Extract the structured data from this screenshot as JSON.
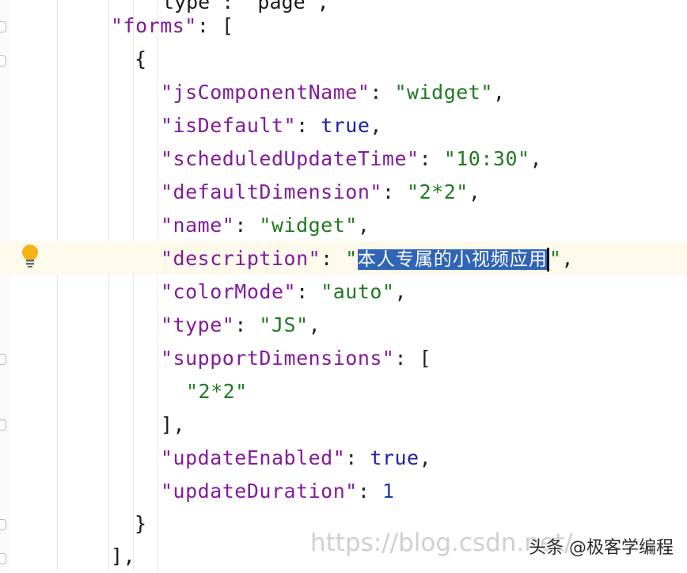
{
  "editor": {
    "top_partial": "type\": \"page\",",
    "lines": {
      "forms_open": {
        "key": "\"forms\"",
        "sep": ": ",
        "open": "["
      },
      "obj_open": "{",
      "jsComponentName": {
        "key": "\"jsComponentName\"",
        "sep": ": ",
        "value": "\"widget\"",
        "end": ","
      },
      "isDefault": {
        "key": "\"isDefault\"",
        "sep": ": ",
        "value": "true",
        "end": ","
      },
      "scheduledUpdateTime": {
        "key": "\"scheduledUpdateTime\"",
        "sep": ": ",
        "value": "\"10:30\"",
        "end": ","
      },
      "defaultDimension": {
        "key": "\"defaultDimension\"",
        "sep": ": ",
        "value": "\"2*2\"",
        "end": ","
      },
      "name": {
        "key": "\"name\"",
        "sep": ": ",
        "value": "\"widget\"",
        "end": ","
      },
      "description": {
        "key": "\"description\"",
        "sep": ": ",
        "quote_open": "\"",
        "value": "本人专属的小视频应用",
        "quote_close": "\"",
        "end": ","
      },
      "colorMode": {
        "key": "\"colorMode\"",
        "sep": ": ",
        "value": "\"auto\"",
        "end": ","
      },
      "type": {
        "key": "\"type\"",
        "sep": ": ",
        "value": "\"JS\"",
        "end": ","
      },
      "supportDimensions": {
        "key": "\"supportDimensions\"",
        "sep": ": ",
        "open": "["
      },
      "dim_item": "\"2*2\"",
      "array_close": "],",
      "updateEnabled": {
        "key": "\"updateEnabled\"",
        "sep": ": ",
        "value": "true",
        "end": ","
      },
      "updateDuration": {
        "key": "\"updateDuration\"",
        "sep": ": ",
        "value": "1"
      },
      "obj_close": "}",
      "forms_close": "],"
    }
  },
  "watermark": {
    "url": "https://blog.csdn.net/",
    "brand": "头条 @极客学编程"
  },
  "colors": {
    "key": "#821b9a",
    "string": "#1f7a1f",
    "keyword": "#1f1fa8",
    "selection": "#2f64b6",
    "current_line": "#fdfaec"
  },
  "icons": [
    "intention-bulb-icon",
    "fold-marker-icon"
  ]
}
